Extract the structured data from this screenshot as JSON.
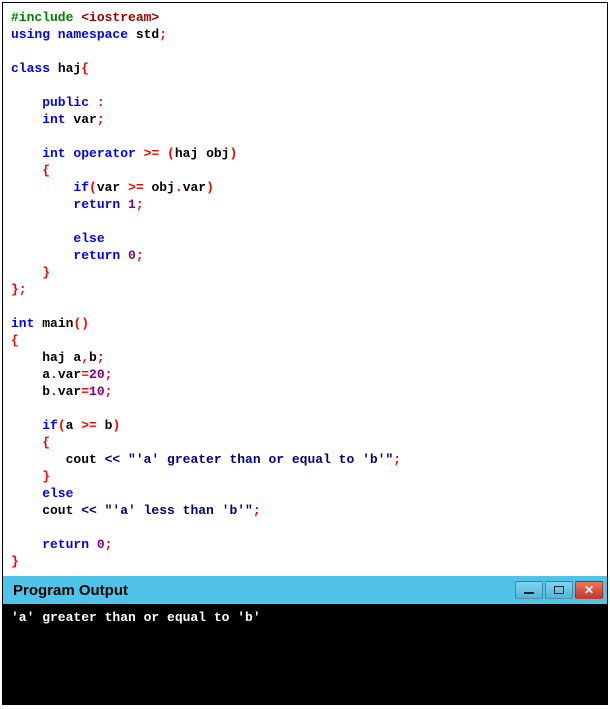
{
  "code": {
    "lines": [
      [
        {
          "t": "#include ",
          "c": "tok-green"
        },
        {
          "t": "<iostream>",
          "c": "tok-maroon"
        }
      ],
      [
        {
          "t": "using namespace ",
          "c": "tok-blue"
        },
        {
          "t": "std",
          "c": "tok-black"
        },
        {
          "t": ";",
          "c": "tok-red"
        }
      ],
      [
        {
          "t": "",
          "c": "tok-black"
        }
      ],
      [
        {
          "t": "class ",
          "c": "tok-blue"
        },
        {
          "t": "haj",
          "c": "tok-black"
        },
        {
          "t": "{",
          "c": "tok-red"
        }
      ],
      [
        {
          "t": "",
          "c": "tok-black"
        }
      ],
      [
        {
          "t": "    public ",
          "c": "tok-blue"
        },
        {
          "t": ":",
          "c": "tok-red"
        }
      ],
      [
        {
          "t": "    int ",
          "c": "tok-blue"
        },
        {
          "t": "var",
          "c": "tok-black"
        },
        {
          "t": ";",
          "c": "tok-red"
        }
      ],
      [
        {
          "t": "",
          "c": "tok-black"
        }
      ],
      [
        {
          "t": "    int ",
          "c": "tok-blue"
        },
        {
          "t": "operator ",
          "c": "tok-blue"
        },
        {
          "t": ">= (",
          "c": "tok-red"
        },
        {
          "t": "haj obj",
          "c": "tok-black"
        },
        {
          "t": ")",
          "c": "tok-red"
        }
      ],
      [
        {
          "t": "    {",
          "c": "tok-red"
        }
      ],
      [
        {
          "t": "        if",
          "c": "tok-blue"
        },
        {
          "t": "(",
          "c": "tok-red"
        },
        {
          "t": "var ",
          "c": "tok-black"
        },
        {
          "t": ">=",
          "c": "tok-red"
        },
        {
          "t": " obj",
          "c": "tok-black"
        },
        {
          "t": ".",
          "c": "tok-red"
        },
        {
          "t": "var",
          "c": "tok-black"
        },
        {
          "t": ")",
          "c": "tok-red"
        }
      ],
      [
        {
          "t": "        return ",
          "c": "tok-blue"
        },
        {
          "t": "1",
          "c": "tok-purple"
        },
        {
          "t": ";",
          "c": "tok-red"
        }
      ],
      [
        {
          "t": "",
          "c": "tok-black"
        }
      ],
      [
        {
          "t": "        else",
          "c": "tok-blue"
        }
      ],
      [
        {
          "t": "        return ",
          "c": "tok-blue"
        },
        {
          "t": "0",
          "c": "tok-purple"
        },
        {
          "t": ";",
          "c": "tok-red"
        }
      ],
      [
        {
          "t": "    }",
          "c": "tok-red"
        }
      ],
      [
        {
          "t": "};",
          "c": "tok-red"
        }
      ],
      [
        {
          "t": "",
          "c": "tok-black"
        }
      ],
      [
        {
          "t": "int ",
          "c": "tok-blue"
        },
        {
          "t": "main",
          "c": "tok-black"
        },
        {
          "t": "()",
          "c": "tok-red"
        }
      ],
      [
        {
          "t": "{",
          "c": "tok-red"
        }
      ],
      [
        {
          "t": "    haj a",
          "c": "tok-black"
        },
        {
          "t": ",",
          "c": "tok-red"
        },
        {
          "t": "b",
          "c": "tok-black"
        },
        {
          "t": ";",
          "c": "tok-red"
        }
      ],
      [
        {
          "t": "    a",
          "c": "tok-black"
        },
        {
          "t": ".",
          "c": "tok-red"
        },
        {
          "t": "var",
          "c": "tok-black"
        },
        {
          "t": "=",
          "c": "tok-red"
        },
        {
          "t": "20",
          "c": "tok-purple"
        },
        {
          "t": ";",
          "c": "tok-red"
        }
      ],
      [
        {
          "t": "    b",
          "c": "tok-black"
        },
        {
          "t": ".",
          "c": "tok-red"
        },
        {
          "t": "var",
          "c": "tok-black"
        },
        {
          "t": "=",
          "c": "tok-red"
        },
        {
          "t": "10",
          "c": "tok-purple"
        },
        {
          "t": ";",
          "c": "tok-red"
        }
      ],
      [
        {
          "t": "",
          "c": "tok-black"
        }
      ],
      [
        {
          "t": "    if",
          "c": "tok-blue"
        },
        {
          "t": "(",
          "c": "tok-red"
        },
        {
          "t": "a ",
          "c": "tok-black"
        },
        {
          "t": ">=",
          "c": "tok-red"
        },
        {
          "t": " b",
          "c": "tok-black"
        },
        {
          "t": ")",
          "c": "tok-red"
        }
      ],
      [
        {
          "t": "    {",
          "c": "tok-red"
        }
      ],
      [
        {
          "t": "       cout ",
          "c": "tok-black"
        },
        {
          "t": "<< ",
          "c": "tok-navy"
        },
        {
          "t": "\"'a' greater than or equal to 'b'\"",
          "c": "tok-navy"
        },
        {
          "t": ";",
          "c": "tok-red"
        }
      ],
      [
        {
          "t": "    }",
          "c": "tok-red"
        }
      ],
      [
        {
          "t": "    else",
          "c": "tok-blue"
        }
      ],
      [
        {
          "t": "    cout ",
          "c": "tok-black"
        },
        {
          "t": "<< ",
          "c": "tok-navy"
        },
        {
          "t": "\"'a' less than 'b'\"",
          "c": "tok-navy"
        },
        {
          "t": ";",
          "c": "tok-red"
        }
      ],
      [
        {
          "t": "",
          "c": "tok-black"
        }
      ],
      [
        {
          "t": "    return ",
          "c": "tok-blue"
        },
        {
          "t": "0",
          "c": "tok-purple"
        },
        {
          "t": ";",
          "c": "tok-red"
        }
      ],
      [
        {
          "t": "}",
          "c": "tok-red"
        }
      ]
    ]
  },
  "output": {
    "title": "Program Output",
    "text": "'a' greater than or equal to 'b'"
  }
}
